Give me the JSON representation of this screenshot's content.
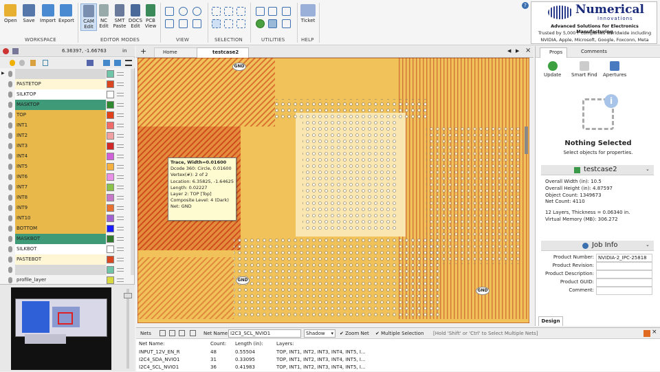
{
  "ribbon": {
    "groups": [
      {
        "label": "WORKSPACE",
        "buttons": [
          "Open",
          "Save",
          "Import",
          "Export"
        ]
      },
      {
        "label": "EDITOR MODES",
        "buttons": [
          "CAM Edit",
          "NC Edit",
          "SMT Paste",
          "DOCS Edit",
          "PCB View"
        ]
      },
      {
        "label": "VIEW"
      },
      {
        "label": "SELECTION"
      },
      {
        "label": "UTILITIES"
      },
      {
        "label": "HELP",
        "buttons": [
          "Ticket"
        ]
      }
    ]
  },
  "logo": {
    "name_line1": "Numerical",
    "name_line2": "Innovations",
    "tagline": "Advanced Solutions for Electronics Manufacturing",
    "trust1": "Trusted by 5,000+ companies worldwide including",
    "trust2": "NVIDIA, Apple, Microsoft, Google, Foxconn, Meta"
  },
  "coords": {
    "readout": "6.36397, -1.66763",
    "unit": "in"
  },
  "layers": [
    {
      "name": "",
      "color": "#6fc5a8",
      "bg": "#d8d8d8"
    },
    {
      "name": "PASTETOP",
      "color": "#d9461f",
      "bg": "#fff6d6"
    },
    {
      "name": "SILKTOP",
      "color": "#ffffff",
      "bg": "#ffffff"
    },
    {
      "name": "MASKTOP",
      "color": "#2f8a2f",
      "bg": "#3f9a78"
    },
    {
      "name": "TOP",
      "color": "#e0401a",
      "bg": "#e8b94a"
    },
    {
      "name": "INT1",
      "color": "#f06a6a",
      "bg": "#e8b94a"
    },
    {
      "name": "INT2",
      "color": "#f0a0a0",
      "bg": "#e8b94a"
    },
    {
      "name": "INT3",
      "color": "#d02828",
      "bg": "#e8b94a"
    },
    {
      "name": "INT4",
      "color": "#d060d8",
      "bg": "#e8b94a"
    },
    {
      "name": "INT5",
      "color": "#f6b040",
      "bg": "#e8b94a"
    },
    {
      "name": "INT6",
      "color": "#e890e8",
      "bg": "#e8b94a"
    },
    {
      "name": "INT7",
      "color": "#8ac24a",
      "bg": "#e8b94a"
    },
    {
      "name": "INT8",
      "color": "#c878c8",
      "bg": "#e8b94a"
    },
    {
      "name": "INT9",
      "color": "#e87030",
      "bg": "#e8b94a"
    },
    {
      "name": "INT10",
      "color": "#a060d0",
      "bg": "#e8b94a"
    },
    {
      "name": "BOTTOM",
      "color": "#1a1aff",
      "bg": "#e8b94a"
    },
    {
      "name": "MASKBOT",
      "color": "#2f7a2f",
      "bg": "#3f9a78"
    },
    {
      "name": "SILKBOT",
      "color": "#ffffff",
      "bg": "#ffffff"
    },
    {
      "name": "PASTEBOT",
      "color": "#d9461f",
      "bg": "#fff6d6"
    },
    {
      "name": "",
      "color": "#6fc5a8",
      "bg": "#d8d8d8"
    },
    {
      "name": "profile_layer",
      "color": "#d8d840",
      "bg": "#f3f3f3"
    }
  ],
  "tabs": {
    "home": "Home",
    "active": "testcase2"
  },
  "tooltip": {
    "title": "Trace, Width=0.01600",
    "lines": [
      "Dcode 360: Circle, 0.01600",
      "Vertex(#): 2 of 2",
      "Location: 6.35825, -1.64625",
      "Length: 0.02227",
      "Layer 2: TOP [Top]",
      "Composite Level: 4  (Dark)",
      "Net: GND"
    ]
  },
  "gnd_label": "GND",
  "right": {
    "tabs": [
      "Props",
      "Comments"
    ],
    "tools": [
      "Update",
      "Smart Find",
      "Apertures"
    ],
    "nothing_title": "Nothing Selected",
    "nothing_sub": "Select objects for properties.",
    "file_header": "testcase2",
    "stats": [
      "Overall Width (in): 10.5",
      "Overall Height (in): 4.87597",
      "Object Count: 1349673",
      "Net Count: 4110",
      "",
      "12 Layers, Thickness = 0.06340 in.",
      "Virtual Memory (MB): 306.272"
    ],
    "job_header": "Job Info",
    "job_rows": [
      {
        "k": "Product Number:",
        "v": "NVIDIA-2_IPC-25818"
      },
      {
        "k": "Product Revision:",
        "v": ""
      },
      {
        "k": "Product Description:",
        "v": ""
      },
      {
        "k": "Product GUID:",
        "v": ""
      },
      {
        "k": "Comment:",
        "v": ""
      }
    ],
    "design_tab": "Design"
  },
  "nets": {
    "label": "Nets",
    "netname_label": "Net Name:",
    "netname_value": "I2C3_SCL_NVIO1",
    "shadow": "Shadow",
    "zoom_net": "Zoom Net",
    "multi": "Multiple Selection",
    "hint": "[Hold 'Shift' or 'Ctrl' to Select Multiple Nets]",
    "columns": [
      "Net Name:",
      "Count:",
      "Length (in):",
      "Layers:"
    ],
    "rows": [
      [
        "INPUT_12V_EN_R",
        "48",
        "0.55504",
        "TOP, INT1, INT2, INT3, INT4, INT5, I..."
      ],
      [
        "I2C4_SDA_NVIO1",
        "31",
        "0.33095",
        "TOP, INT1, INT2, INT3, INT4, INT5, I..."
      ],
      [
        "I2C4_SCL_NVIO1",
        "36",
        "0.41983",
        "TOP, INT1, INT2, INT3, INT4, INT5, I..."
      ]
    ]
  }
}
